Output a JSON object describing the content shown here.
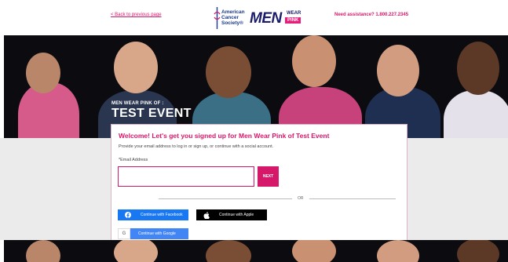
{
  "header": {
    "back_link": "< Back to previous page",
    "assistance": "Need assistance? 1.800.227.2345",
    "acs_logo": {
      "line1": "American",
      "line2": "Cancer",
      "line3": "Society®"
    },
    "mwp_logo": {
      "men": "MEN",
      "wear": "WEAR",
      "pink": "PINK"
    }
  },
  "hero": {
    "subtitle": "MEN WEAR PINK OF :",
    "title": "TEST EVENT"
  },
  "form": {
    "title": "Welcome! Let's get you signed up for Men Wear Pink of Test Event",
    "description": "Provide your email address to log in or sign up, or continue with a social account.",
    "email_label": "*Email Address",
    "email_value": "",
    "next_label": "NEXT",
    "or_label": "OR",
    "facebook_label": "Continue with Facebook",
    "apple_label": "Continue with Apple",
    "google_label": "Continue with Google"
  },
  "colors": {
    "brand_pink": "#d6186a",
    "acs_blue": "#1a3a8f",
    "facebook": "#1877f2",
    "apple": "#000000",
    "google": "#4285f4"
  },
  "icons": [
    "sword-icon",
    "facebook-icon",
    "apple-icon",
    "google-icon"
  ]
}
